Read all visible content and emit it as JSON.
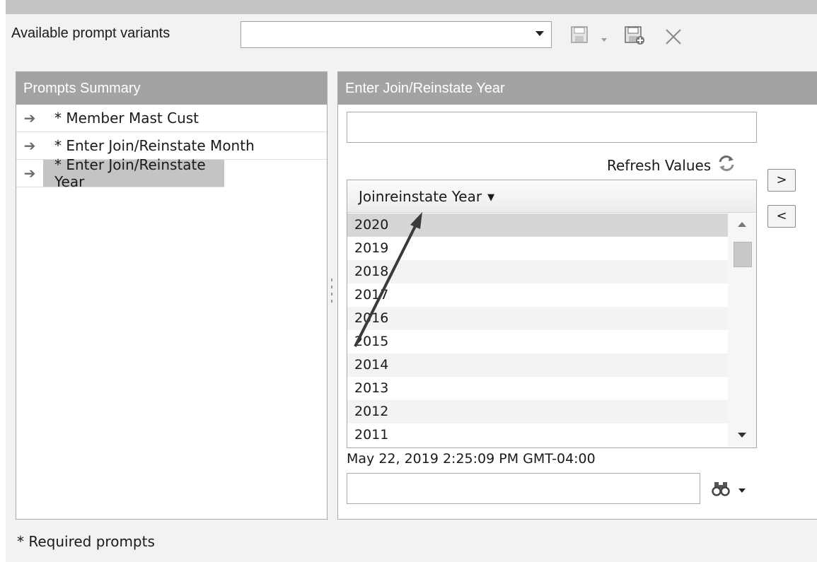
{
  "toolbar": {
    "variants_label": "Available prompt variants",
    "variants_value": ""
  },
  "prompts_summary": {
    "title": "Prompts Summary",
    "items": [
      {
        "label": "* Member Mast Cust"
      },
      {
        "label": "* Enter Join/Reinstate Month"
      },
      {
        "label": "* Enter Join/Reinstate Year"
      }
    ],
    "selected_index": 2
  },
  "prompt_detail": {
    "title": "Enter Join/Reinstate Year",
    "input_value": "",
    "refresh_label": "Refresh Values",
    "add_button": ">",
    "remove_button": "<",
    "list": {
      "column_header": "Joinreinstate Year",
      "rows": [
        "2020",
        "2019",
        "2018",
        "2017",
        "2016",
        "2015",
        "2014",
        "2013",
        "2012",
        "2011"
      ]
    },
    "timestamp": "May 22, 2019 2:25:09 PM GMT-04:00",
    "search_value": ""
  },
  "footer": {
    "note": "* Required prompts"
  },
  "icons": {
    "save": "save-icon",
    "save_as": "save-as-icon",
    "delete": "close-icon",
    "refresh": "refresh-icon",
    "search": "binoculars-icon"
  },
  "colors": {
    "header_bg": "#a3a3a3",
    "selected_bg": "#c4c4c4"
  }
}
